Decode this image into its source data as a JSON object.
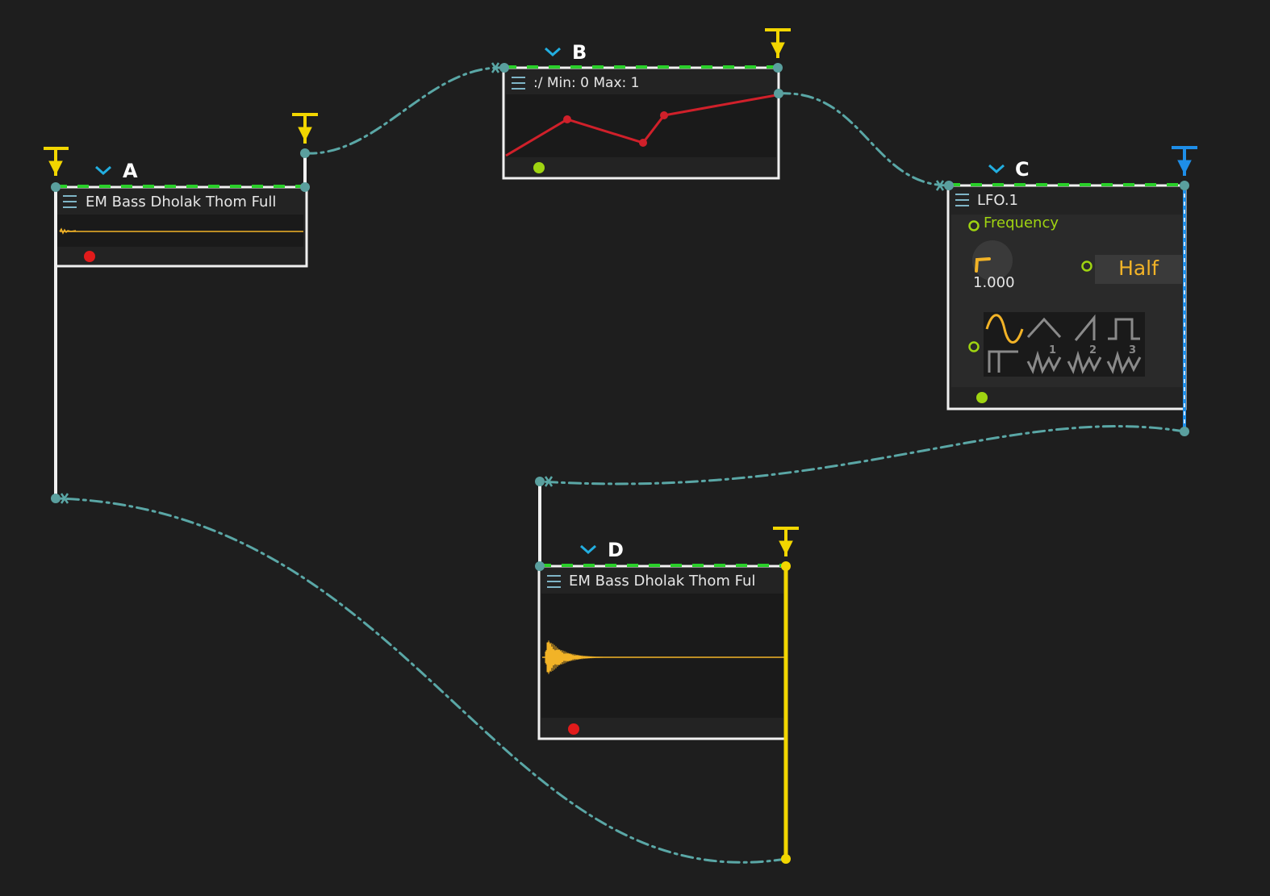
{
  "colors": {
    "background": "#1e1e1e",
    "node_fill": "#232323",
    "node_inner": "#1a1a1a",
    "node_border": "#f0f0f0",
    "cable": "#5aa7a6",
    "port_dot": "#5a9f9e",
    "green_dash": "#2ad02a",
    "yellow": "#f2d600",
    "blue": "#1e8ee8",
    "waveform": "#f2b327",
    "line_red": "#d0202a",
    "record_red": "#e11b1b",
    "lime": "#9fd411",
    "cyan_chevron": "#22aee0",
    "menu_icon": "#7fb5c7"
  },
  "nodes": {
    "a": {
      "label": "A",
      "title": "EM Bass Dholak Thom Full"
    },
    "b": {
      "label": "B",
      "range_text": ":/  Min: 0  Max: 1"
    },
    "c": {
      "label": "C",
      "title": "LFO.1",
      "param_label": "Frequency",
      "knob_value": "1.000",
      "mode_button": "Half",
      "waveforms": [
        {
          "name": "sine",
          "index": ""
        },
        {
          "name": "triangle",
          "index": ""
        },
        {
          "name": "saw",
          "index": ""
        },
        {
          "name": "square",
          "index": ""
        },
        {
          "name": "pulse",
          "index": ""
        },
        {
          "name": "random-1",
          "index": "1"
        },
        {
          "name": "random-2",
          "index": "2"
        },
        {
          "name": "random-3",
          "index": "3"
        }
      ],
      "selected_waveform": "sine"
    },
    "d": {
      "label": "D",
      "title": "EM Bass Dholak Thom Ful"
    }
  },
  "icons": [
    "chevron-down-icon",
    "menu-icon",
    "output-port-icon",
    "record-dot-icon",
    "status-dot-icon"
  ]
}
